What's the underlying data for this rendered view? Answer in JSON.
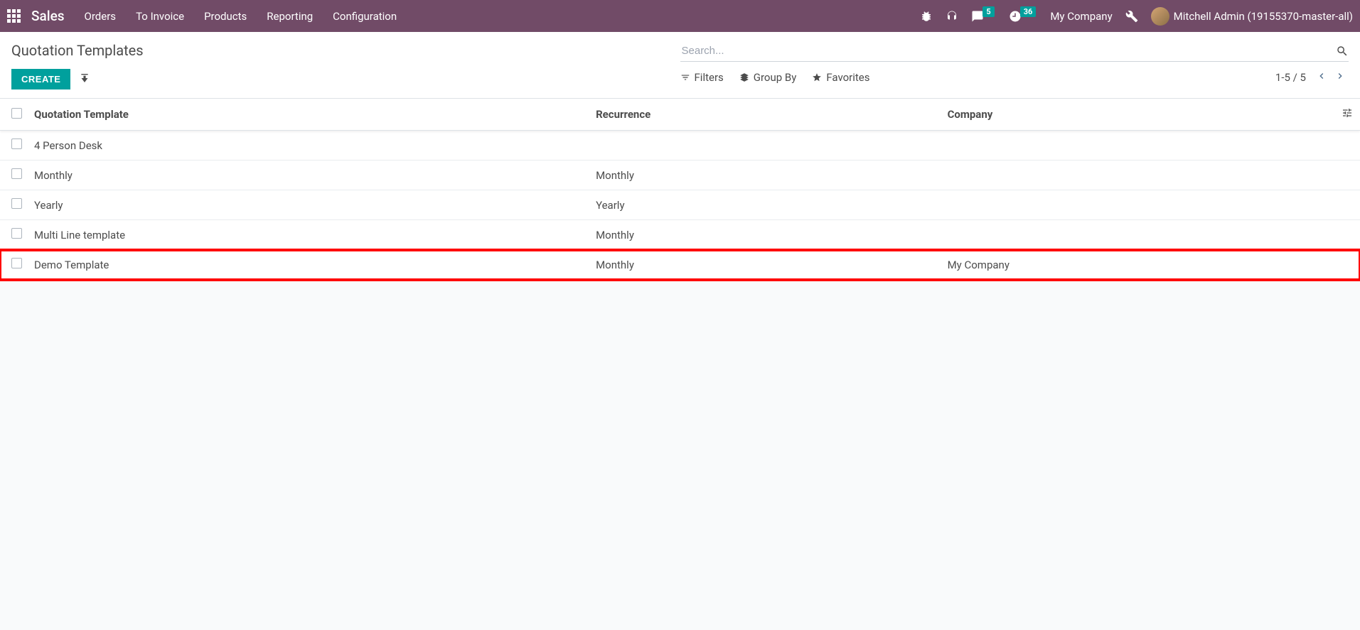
{
  "navbar": {
    "brand": "Sales",
    "menu": [
      "Orders",
      "To Invoice",
      "Products",
      "Reporting",
      "Configuration"
    ],
    "message_badge": "5",
    "timer_badge": "36",
    "company": "My Company",
    "user": "Mitchell Admin (19155370-master-all)"
  },
  "page": {
    "title": "Quotation Templates",
    "create_label": "CREATE",
    "search_placeholder": "Search...",
    "filters_label": "Filters",
    "groupby_label": "Group By",
    "favorites_label": "Favorites",
    "pager": "1-5 / 5"
  },
  "table": {
    "columns": [
      "Quotation Template",
      "Recurrence",
      "Company"
    ],
    "rows": [
      {
        "name": "4 Person Desk",
        "recurrence": "",
        "company": "",
        "highlight": false
      },
      {
        "name": "Monthly",
        "recurrence": "Monthly",
        "company": "",
        "highlight": false
      },
      {
        "name": "Yearly",
        "recurrence": "Yearly",
        "company": "",
        "highlight": false
      },
      {
        "name": "Multi Line template",
        "recurrence": "Monthly",
        "company": "",
        "highlight": false
      },
      {
        "name": "Demo Template",
        "recurrence": "Monthly",
        "company": "My Company",
        "highlight": true
      }
    ]
  }
}
